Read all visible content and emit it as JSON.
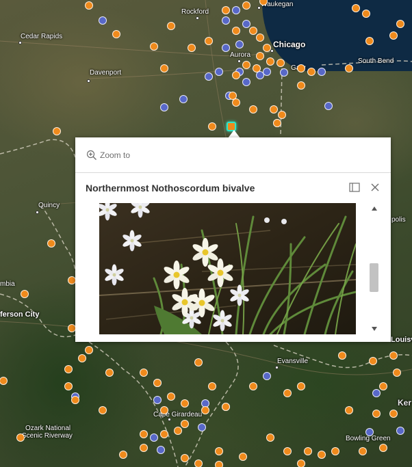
{
  "map": {
    "cities": {
      "waukegan": "Waukegan",
      "rockford": "Rockford",
      "cedar_rapids": "Cedar Rapids",
      "chicago": "Chicago",
      "aurora": "Aurora",
      "south_bend": "South Bend",
      "gary": "Gary",
      "davenport": "Davenport",
      "quincy": "Quincy",
      "columbia": "mbia",
      "jefferson_city": "ferson City",
      "indianapolis": "polis",
      "evansville": "Evansville",
      "louisville": "Louisvi",
      "cape_girardeau": "Cape Girardeau",
      "kentucky": "Ker",
      "bowling_green": "Bowling Green",
      "ozark_line1": "Ozark National",
      "ozark_line2": "Scenic Riverway"
    },
    "colors": {
      "orange_marker": "#ef8a1c",
      "blue_marker": "#5868c8",
      "selected_outline": "#2ee6c8",
      "water": "#0e2a44"
    }
  },
  "popup": {
    "zoom_label": "Zoom to",
    "title": "Northernmost Nothoscordum bivalve",
    "image_alt": "White star-shaped flowers with yellow centers among grass",
    "scroll_fraction": 0.55
  }
}
